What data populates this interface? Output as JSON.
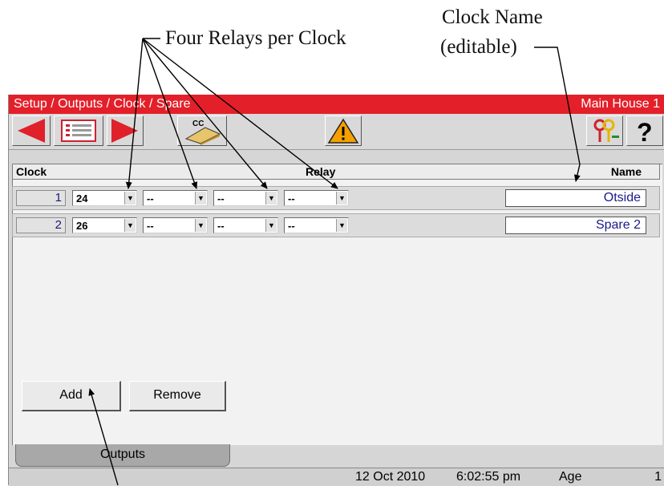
{
  "annotations": {
    "relays": "Four Relays per Clock",
    "clock_name_line1": "Clock Name",
    "clock_name_line2": "(editable)"
  },
  "titlebar": {
    "breadcrumb": "Setup / Outputs / Clock / Spare",
    "location": "Main House 1",
    "color": "#e3202a"
  },
  "toolbar": {
    "buttons": [
      {
        "icon": "left-arrow-icon",
        "color": "#e0202a"
      },
      {
        "icon": "list-icon"
      },
      {
        "icon": "right-arrow-icon",
        "color": "#e0202a"
      },
      {
        "icon": "controller-cc-icon",
        "label": "CC"
      },
      {
        "icon": "warning-icon",
        "color": "#f5a000"
      },
      {
        "icon": "keys-icon"
      },
      {
        "icon": "help-icon",
        "label": "?"
      }
    ]
  },
  "table": {
    "headers": {
      "clock": "Clock",
      "relay": "Relay",
      "name": "Name"
    },
    "rows": [
      {
        "clock": "1",
        "relays": [
          "24",
          "--",
          "--",
          "--"
        ],
        "name": "Otside"
      },
      {
        "clock": "2",
        "relays": [
          "26",
          "--",
          "--",
          "--"
        ],
        "name": "Spare 2"
      }
    ]
  },
  "actions": {
    "add": "Add",
    "remove": "Remove"
  },
  "tab": {
    "label": "Outputs"
  },
  "status": {
    "date": "12 Oct 2010",
    "time": "6:02:55 pm",
    "age_label": "Age",
    "age_value": "1"
  }
}
